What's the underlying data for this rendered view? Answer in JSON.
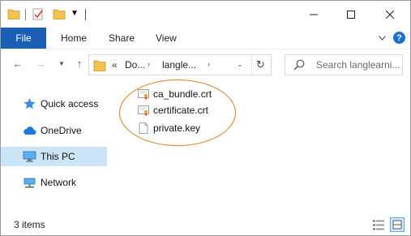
{
  "window": {
    "title": ""
  },
  "ribbon": {
    "tabs": [
      {
        "label": "File"
      },
      {
        "label": "Home"
      },
      {
        "label": "Share"
      },
      {
        "label": "View"
      }
    ]
  },
  "address": {
    "segments": [
      "Do...",
      "langle..."
    ]
  },
  "search": {
    "placeholder": "Search langlearni..."
  },
  "navigation": {
    "items": [
      {
        "label": "Quick access",
        "icon": "star-icon"
      },
      {
        "label": "OneDrive",
        "icon": "cloud-icon"
      },
      {
        "label": "This PC",
        "icon": "computer-icon",
        "selected": true
      },
      {
        "label": "Network",
        "icon": "network-icon"
      }
    ]
  },
  "files": [
    {
      "name": "ca_bundle.crt",
      "icon": "certificate-icon"
    },
    {
      "name": "certificate.crt",
      "icon": "certificate-icon"
    },
    {
      "name": "private.key",
      "icon": "file-icon"
    }
  ],
  "status": {
    "count": "3 items"
  },
  "colors": {
    "accent": "#1a5fb4",
    "selection": "#cce4f7",
    "annotation": "#e07b20"
  }
}
